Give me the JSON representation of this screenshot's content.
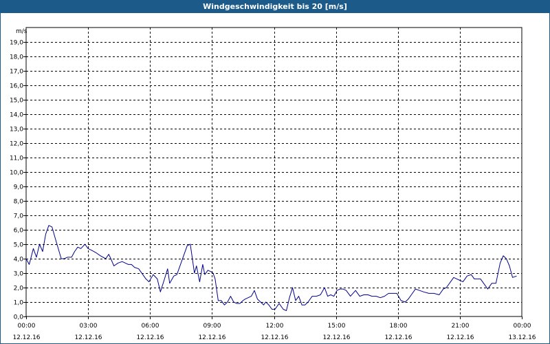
{
  "window": {
    "title": "Windgeschwindigkeit bis 20 [m/s]"
  },
  "chart_data": {
    "type": "line",
    "title": "Windgeschwindigkeit bis 20 [m/s]",
    "ylabel": "m/s",
    "ylim": [
      0,
      20
    ],
    "xlim_hours": [
      0,
      24
    ],
    "grid": true,
    "y_ticks": [
      "0,0",
      "1,0",
      "2,0",
      "3,0",
      "4,0",
      "5,0",
      "6,0",
      "7,0",
      "8,0",
      "9,0",
      "10,0",
      "11,0",
      "12,0",
      "13,0",
      "14,0",
      "15,0",
      "16,0",
      "17,0",
      "18,0",
      "19,0"
    ],
    "x_ticks": [
      {
        "time": "00:00",
        "date": "12.12.16"
      },
      {
        "time": "03:00",
        "date": "12.12.16"
      },
      {
        "time": "06:00",
        "date": "12.12.16"
      },
      {
        "time": "09:00",
        "date": "12.12.16"
      },
      {
        "time": "12:00",
        "date": "12.12.16"
      },
      {
        "time": "15:00",
        "date": "12.12.16"
      },
      {
        "time": "18:00",
        "date": "12.12.16"
      },
      {
        "time": "21:00",
        "date": "12.12.16"
      },
      {
        "time": "00:00",
        "date": "13.12.16"
      }
    ],
    "series": [
      {
        "color": "#00008b",
        "x_hours": [
          0.0,
          0.15,
          0.35,
          0.5,
          0.65,
          0.8,
          0.95,
          1.1,
          1.25,
          1.45,
          1.7,
          1.85,
          2.0,
          2.2,
          2.35,
          2.5,
          2.65,
          2.85,
          3.0,
          3.15,
          3.4,
          3.6,
          3.85,
          4.0,
          4.1,
          4.25,
          4.45,
          4.65,
          4.8,
          4.95,
          5.1,
          5.25,
          5.45,
          5.65,
          5.8,
          5.95,
          6.15,
          6.35,
          6.5,
          6.7,
          6.85,
          6.95,
          7.15,
          7.3,
          7.5,
          7.65,
          7.8,
          7.95,
          8.15,
          8.25,
          8.4,
          8.55,
          8.65,
          8.8,
          8.95,
          9.05,
          9.15,
          9.3,
          9.45,
          9.6,
          9.75,
          9.9,
          10.05,
          10.2,
          10.35,
          10.5,
          10.6,
          10.75,
          10.9,
          11.05,
          11.2,
          11.35,
          11.5,
          11.6,
          11.75,
          11.9,
          12.05,
          12.25,
          12.45,
          12.6,
          12.75,
          12.9,
          13.05,
          13.2,
          13.35,
          13.5,
          13.65,
          13.85,
          14.05,
          14.25,
          14.45,
          14.6,
          14.75,
          14.9,
          15.05,
          15.2,
          15.35,
          15.5,
          15.7,
          15.95,
          16.15,
          16.35,
          16.55,
          16.75,
          16.95,
          17.15,
          17.35,
          17.55,
          17.75,
          17.95,
          18.15,
          18.35,
          18.5,
          18.65,
          18.85,
          19.05,
          19.25,
          19.5,
          19.75,
          20.0,
          20.2,
          20.35,
          20.55,
          20.7,
          20.85,
          21.0,
          21.15,
          21.35,
          21.55,
          21.7,
          21.85,
          22.0,
          22.15,
          22.35,
          22.55,
          22.75,
          22.95,
          23.1,
          23.25,
          23.4,
          23.55,
          23.75
        ],
        "values": [
          4.0,
          3.6,
          4.7,
          4.1,
          5.0,
          4.5,
          5.7,
          6.3,
          6.2,
          5.2,
          4.0,
          4.0,
          4.1,
          4.1,
          4.5,
          4.8,
          4.7,
          5.0,
          4.7,
          4.6,
          4.4,
          4.2,
          4.0,
          4.3,
          4.0,
          3.5,
          3.7,
          3.8,
          3.7,
          3.6,
          3.6,
          3.4,
          3.3,
          2.9,
          2.6,
          2.4,
          2.9,
          2.6,
          1.7,
          2.6,
          3.3,
          2.3,
          2.8,
          2.9,
          3.7,
          4.3,
          4.9,
          5.0,
          3.0,
          3.5,
          2.4,
          3.6,
          2.9,
          3.2,
          3.1,
          3.0,
          2.6,
          1.1,
          1.1,
          0.8,
          1.0,
          1.4,
          1.0,
          0.9,
          0.9,
          1.1,
          1.2,
          1.3,
          1.4,
          1.8,
          1.2,
          1.0,
          0.8,
          1.0,
          0.8,
          0.5,
          0.5,
          0.9,
          0.5,
          0.4,
          1.3,
          2.0,
          1.1,
          1.4,
          0.8,
          0.8,
          1.0,
          1.4,
          1.4,
          1.5,
          2.0,
          1.4,
          1.5,
          1.4,
          1.8,
          1.9,
          1.9,
          1.8,
          1.4,
          1.8,
          1.4,
          1.5,
          1.5,
          1.4,
          1.4,
          1.3,
          1.4,
          1.6,
          1.6,
          1.6,
          1.1,
          1.0,
          1.2,
          1.5,
          1.9,
          1.8,
          1.7,
          1.6,
          1.6,
          1.5,
          1.9,
          2.0,
          2.4,
          2.7,
          2.6,
          2.5,
          2.4,
          2.8,
          2.9,
          2.6,
          2.6,
          2.6,
          2.3,
          1.9,
          2.3,
          2.3,
          3.7,
          4.2,
          4.0,
          3.5,
          2.7,
          2.8,
          2.4,
          1.8
        ]
      }
    ]
  }
}
